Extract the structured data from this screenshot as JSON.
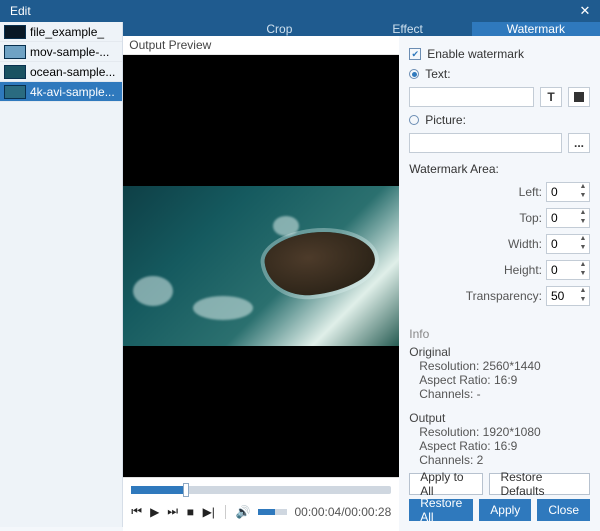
{
  "window": {
    "title": "Edit"
  },
  "files": [
    {
      "name": "file_example_",
      "thumb": "dark"
    },
    {
      "name": "mov-sample-...",
      "thumb": "light"
    },
    {
      "name": "ocean-sample...",
      "thumb": "teal"
    },
    {
      "name": "4k-avi-sample...",
      "thumb": "ocean",
      "selected": true
    }
  ],
  "tabs": {
    "crop": "Crop",
    "effect": "Effect",
    "watermark": "Watermark",
    "active": "watermark"
  },
  "preview": {
    "label": "Output Preview"
  },
  "timecode": "00:00:04/00:00:28",
  "watermark": {
    "enable_label": "Enable watermark",
    "text_label": "Text:",
    "picture_label": "Picture:",
    "text_value": "",
    "picture_value": "",
    "font_btn": "T",
    "color_btn_name": "text-color-button",
    "browse_btn": "...",
    "area_label": "Watermark Area:",
    "left_label": "Left:",
    "left": 0,
    "top_label": "Top:",
    "top": 0,
    "width_label": "Width:",
    "width": 0,
    "height_label": "Height:",
    "height": 0,
    "trans_label": "Transparency:",
    "trans": 50
  },
  "info": {
    "hdr": "Info",
    "orig_label": "Original",
    "orig_res_label": "Resolution:",
    "orig_res": "2560*1440",
    "orig_ar_label": "Aspect Ratio:",
    "orig_ar": "16:9",
    "orig_ch_label": "Channels:",
    "orig_ch": "-",
    "out_label": "Output",
    "out_res_label": "Resolution:",
    "out_res": "1920*1080",
    "out_ar_label": "Aspect Ratio:",
    "out_ar": "16:9",
    "out_ch_label": "Channels:",
    "out_ch": "2"
  },
  "buttons": {
    "apply_all": "Apply to All",
    "restore_defaults": "Restore Defaults",
    "restore_all": "Restore All",
    "apply": "Apply",
    "close": "Close"
  }
}
